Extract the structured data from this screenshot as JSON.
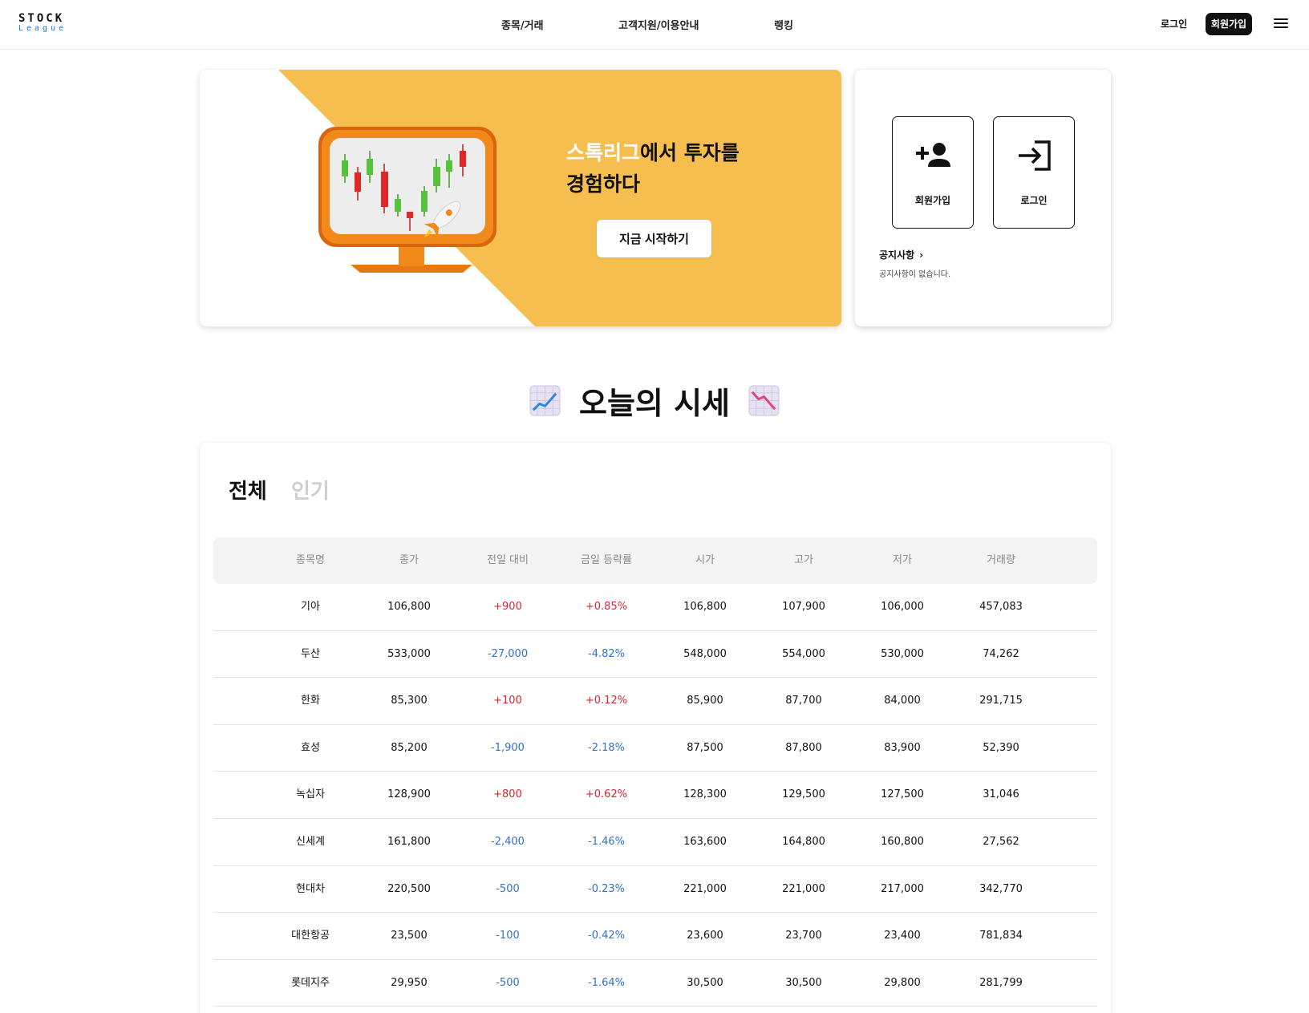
{
  "header": {
    "logo_main": "STOCK",
    "logo_sub": "League",
    "nav": [
      "종목/거래",
      "고객지원/이용안내",
      "랭킹"
    ],
    "login_label": "로그인",
    "signup_label": "회원가입",
    "menu_icon": "hamburger-menu-icon"
  },
  "banner": {
    "title_highlight": "스톡리그",
    "title_rest_line1": "에서 투자를",
    "title_line2": "경험하다",
    "cta_label": "지금 시작하기",
    "accent_color": "#F6BE4F",
    "illustration": "monitor-candlestick-rocket-illustration"
  },
  "side_card": {
    "signup_label": "회원가입",
    "signup_icon": "person-add-icon",
    "login_label": "로그인",
    "login_icon": "login-arrow-icon",
    "notice_title": "공지사항",
    "notice_empty": "공지사항이 없습니다."
  },
  "market": {
    "title": "오늘의 시세",
    "left_emoji": "chart-increasing-icon",
    "right_emoji": "chart-decreasing-icon",
    "tabs": [
      "전체",
      "인기"
    ],
    "columns": [
      "종목명",
      "종가",
      "전일 대비",
      "금일 등락률",
      "시가",
      "고가",
      "저가",
      "거래량"
    ],
    "up_color": "#D8262E",
    "down_color": "#2D72C9",
    "rows": [
      {
        "name": "기아",
        "close": "106,800",
        "change": "+900",
        "rate": "+0.85%",
        "dir": "up",
        "open": "106,800",
        "high": "107,900",
        "low": "106,000",
        "volume": "457,083"
      },
      {
        "name": "두산",
        "close": "533,000",
        "change": "-27,000",
        "rate": "-4.82%",
        "dir": "down",
        "open": "548,000",
        "high": "554,000",
        "low": "530,000",
        "volume": "74,262"
      },
      {
        "name": "한화",
        "close": "85,300",
        "change": "+100",
        "rate": "+0.12%",
        "dir": "up",
        "open": "85,900",
        "high": "87,700",
        "low": "84,000",
        "volume": "291,715"
      },
      {
        "name": "효성",
        "close": "85,200",
        "change": "-1,900",
        "rate": "-2.18%",
        "dir": "down",
        "open": "87,500",
        "high": "87,800",
        "low": "83,900",
        "volume": "52,390"
      },
      {
        "name": "녹십자",
        "close": "128,900",
        "change": "+800",
        "rate": "+0.62%",
        "dir": "up",
        "open": "128,300",
        "high": "129,500",
        "low": "127,500",
        "volume": "31,046"
      },
      {
        "name": "신세계",
        "close": "161,800",
        "change": "-2,400",
        "rate": "-1.46%",
        "dir": "down",
        "open": "163,600",
        "high": "164,800",
        "low": "160,800",
        "volume": "27,562"
      },
      {
        "name": "현대차",
        "close": "220,500",
        "change": "-500",
        "rate": "-0.23%",
        "dir": "down",
        "open": "221,000",
        "high": "221,000",
        "low": "217,000",
        "volume": "342,770"
      },
      {
        "name": "대한항공",
        "close": "23,500",
        "change": "-100",
        "rate": "-0.42%",
        "dir": "down",
        "open": "23,600",
        "high": "23,700",
        "low": "23,400",
        "volume": "781,834"
      },
      {
        "name": "롯데지주",
        "close": "29,950",
        "change": "-500",
        "rate": "-1.64%",
        "dir": "down",
        "open": "30,500",
        "high": "30,500",
        "low": "29,800",
        "volume": "281,799"
      }
    ]
  }
}
